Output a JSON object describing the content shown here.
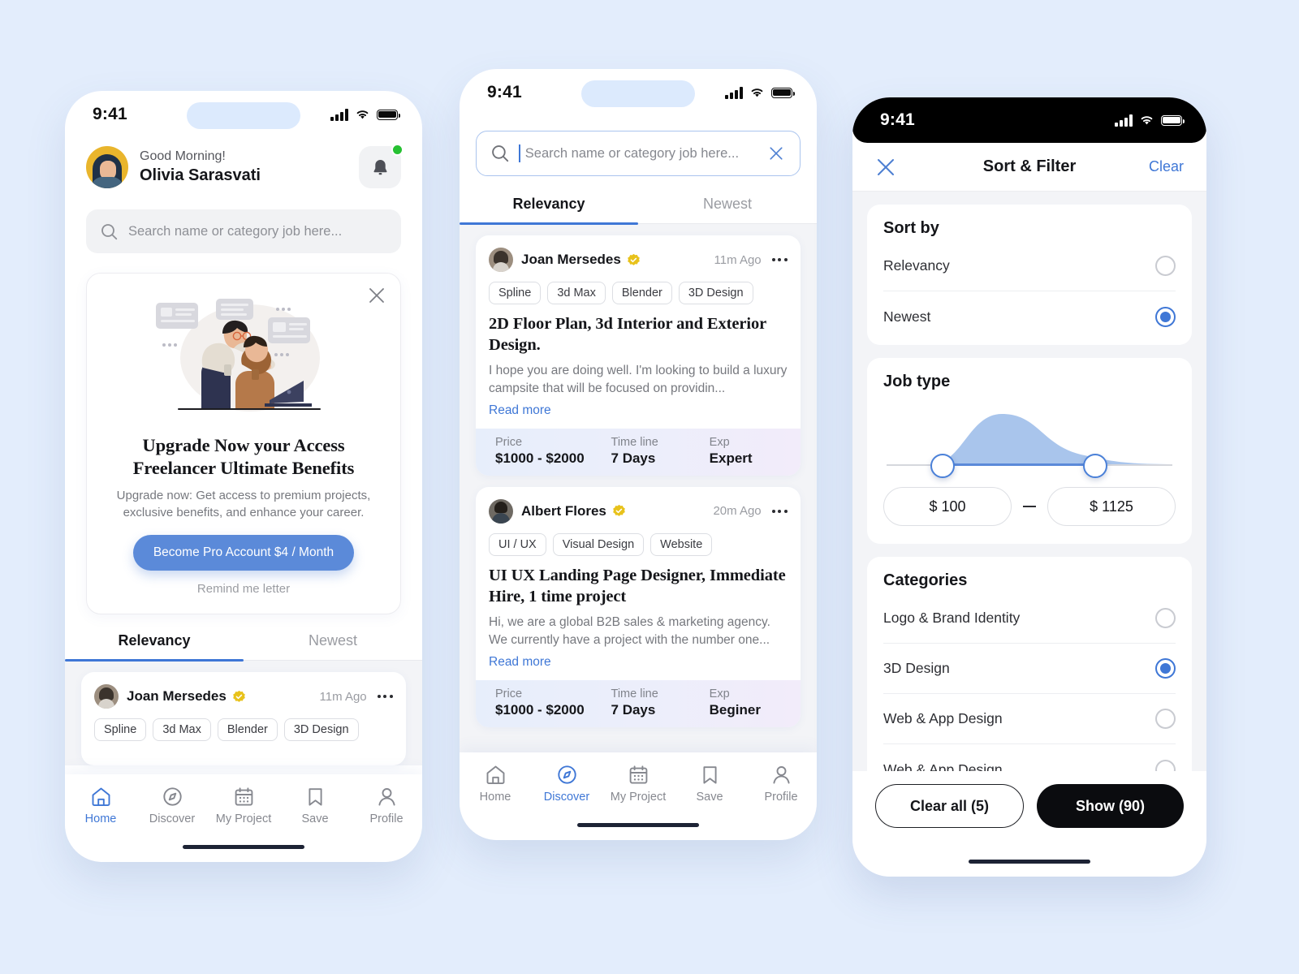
{
  "theme": {
    "page_bg": "#e3edfc",
    "accent_blue": "#3f77d6",
    "button_blue": "#5b8ad9",
    "verified_yellow": "#e8c21b",
    "dark": "#0b0c0f"
  },
  "status_bar": {
    "time": "9:41"
  },
  "phone1": {
    "greeting": "Good Morning!",
    "user_name": "Olivia Sarasvati",
    "bell_icon": "bell-icon",
    "search": {
      "placeholder": "Search name or category job here..."
    },
    "upgrade_card": {
      "close_icon": "close-icon",
      "title": "Upgrade Now your Access Freelancer Ultimate Benefits",
      "subtitle": "Upgrade now: Get access to premium projects, exclusive benefits, and enhance your career.",
      "cta": "Become Pro Account $4 / Month",
      "dismiss": "Remind me letter"
    },
    "tabs": [
      {
        "label": "Relevancy",
        "active": true
      },
      {
        "label": "Newest",
        "active": false
      }
    ],
    "job": {
      "name": "Joan Mersedes",
      "time": "11m Ago",
      "chips": [
        "Spline",
        "3d Max",
        "Blender",
        "3D Design"
      ]
    },
    "nav": [
      {
        "label": "Home",
        "icon": "home-icon",
        "active": true
      },
      {
        "label": "Discover",
        "icon": "compass-icon",
        "active": false
      },
      {
        "label": "My Project",
        "icon": "calendar-icon",
        "active": false
      },
      {
        "label": "Save",
        "icon": "bookmark-icon",
        "active": false
      },
      {
        "label": "Profile",
        "icon": "person-icon",
        "active": false
      }
    ]
  },
  "phone2": {
    "search": {
      "placeholder": "Search name or category job here...",
      "value": "",
      "clear_icon": "close-icon"
    },
    "tabs": [
      {
        "label": "Relevancy",
        "active": true
      },
      {
        "label": "Newest",
        "active": false
      }
    ],
    "jobs": [
      {
        "name": "Joan Mersedes",
        "time": "11m Ago",
        "verified": true,
        "chips": [
          "Spline",
          "3d Max",
          "Blender",
          "3D Design"
        ],
        "title": "2D Floor Plan, 3d Interior and Exterior Design.",
        "description": "I hope you are doing well. I'm looking to build a luxury campsite that will be focused on providin...",
        "read_more": "Read more",
        "meta": [
          {
            "label": "Price",
            "value": "$1000 - $2000"
          },
          {
            "label": "Time line",
            "value": "7 Days"
          },
          {
            "label": "Exp",
            "value": "Expert"
          }
        ]
      },
      {
        "name": "Albert Flores",
        "time": "20m Ago",
        "verified": true,
        "chips": [
          "UI / UX",
          "Visual Design",
          "Website"
        ],
        "title": "UI UX Landing Page Designer, Immediate Hire, 1 time project",
        "description": "Hi, we are a global B2B sales & marketing agency. We currently have a project with the number one...",
        "read_more": "Read more",
        "meta": [
          {
            "label": "Price",
            "value": "$1000 - $2000"
          },
          {
            "label": "Time line",
            "value": "7 Days"
          },
          {
            "label": "Exp",
            "value": "Beginer"
          }
        ]
      }
    ],
    "nav": [
      {
        "label": "Home",
        "icon": "home-icon",
        "active": false
      },
      {
        "label": "Discover",
        "icon": "compass-icon",
        "active": true
      },
      {
        "label": "My Project",
        "icon": "calendar-icon",
        "active": false
      },
      {
        "label": "Save",
        "icon": "bookmark-icon",
        "active": false
      },
      {
        "label": "Profile",
        "icon": "person-icon",
        "active": false
      }
    ]
  },
  "phone3": {
    "header": {
      "close_icon": "close-icon",
      "title": "Sort & Filter",
      "clear": "Clear"
    },
    "sort_by": {
      "heading": "Sort by",
      "options": [
        {
          "label": "Relevancy",
          "selected": false
        },
        {
          "label": "Newest",
          "selected": true
        }
      ]
    },
    "job_type": {
      "heading": "Job type",
      "min_value": "$  100",
      "max_value": "$  1125",
      "separator": "—"
    },
    "categories": {
      "heading": "Categories",
      "options": [
        {
          "label": "Logo & Brand Identity",
          "selected": false
        },
        {
          "label": "3D Design",
          "selected": true
        },
        {
          "label": "Web & App Design",
          "selected": false
        },
        {
          "label": "Web & App Design",
          "selected": false
        }
      ]
    },
    "footer": {
      "clear_all": "Clear all (5)",
      "show": "Show (90)"
    }
  }
}
